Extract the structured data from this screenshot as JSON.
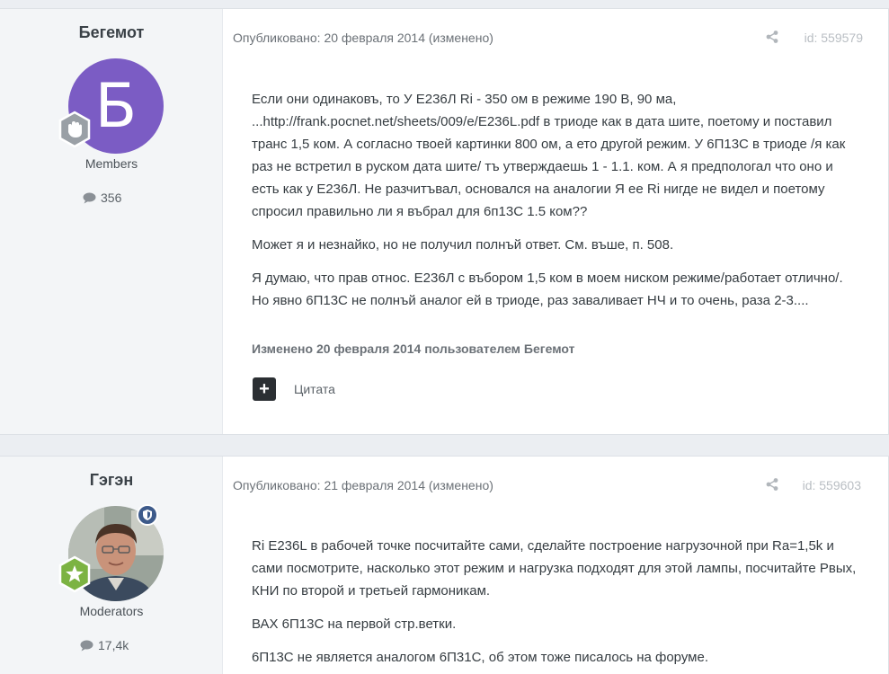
{
  "posts": [
    {
      "author": {
        "name": "Бегемот",
        "avatar_letter": "Б",
        "group": "Members",
        "post_count": "356",
        "avatar_color": "#7b5cc4"
      },
      "meta": "Опубликовано: 20 февраля 2014 (изменено)",
      "post_id": "id: 559579",
      "paragraphs": [
        "Если они одинаковъ, то У Е236Л Ri - 350 ом в режиме 190 В, 90 ма, ...http://frank.pocnet.net/sheets/009/e/E236L.pdf в триоде как в дата шите, поетому и поставил транс 1,5 ком. А согласно твоей картинки 800 ом, а ето другой режим. У 6П13С в триоде /я как раз не встретил в руском дата шите/ тъ утверждаешь 1 - 1.1. ком. А я предпологал что оно и есть как у Е236Л. Не разчитъвал, основался на аналогии Я ее Ri нигде не видел и поетому спросил правильно ли я въбрал для 6п13С 1.5 ком??",
        "Может я и незнайко, но не получил полнъй ответ. См. въше, п. 508.",
        "Я думаю, что прав относ. Е236Л с въбором 1,5 ком в моем ниском режиме/работает отлично/. Но явно 6П13С не полнъй аналог ей в триоде, раз заваливает НЧ и то очень, раза 2-3...."
      ],
      "edited": "Изменено 20 февраля 2014 пользователем Бегемот",
      "quote_label": "Цитата"
    },
    {
      "author": {
        "name": "Гэгэн",
        "group": "Moderators",
        "post_count": "17,4k"
      },
      "meta": "Опубликовано: 21 февраля 2014 (изменено)",
      "post_id": "id: 559603",
      "paragraphs": [
        "Ri E236L в рабочей точке посчитайте сами, сделайте построение нагрузочной при Ra=1,5k и сами посмотрите, насколько этот режим и нагрузка подходят для этой лампы, посчитайте Рвых, КНИ по второй и третьей гармоникам.",
        "ВАХ 6П13С на первой стр.ветки.",
        "6П13С не является аналогом 6П31С, об этом тоже писалось на форуме."
      ]
    }
  ],
  "icons": {
    "comment": "comment-icon",
    "share": "share-icon",
    "rank_badge": "hand-badge-icon",
    "star_badge": "star-badge-icon",
    "mod_badge": "shield-icon",
    "plus": "plus-icon"
  }
}
